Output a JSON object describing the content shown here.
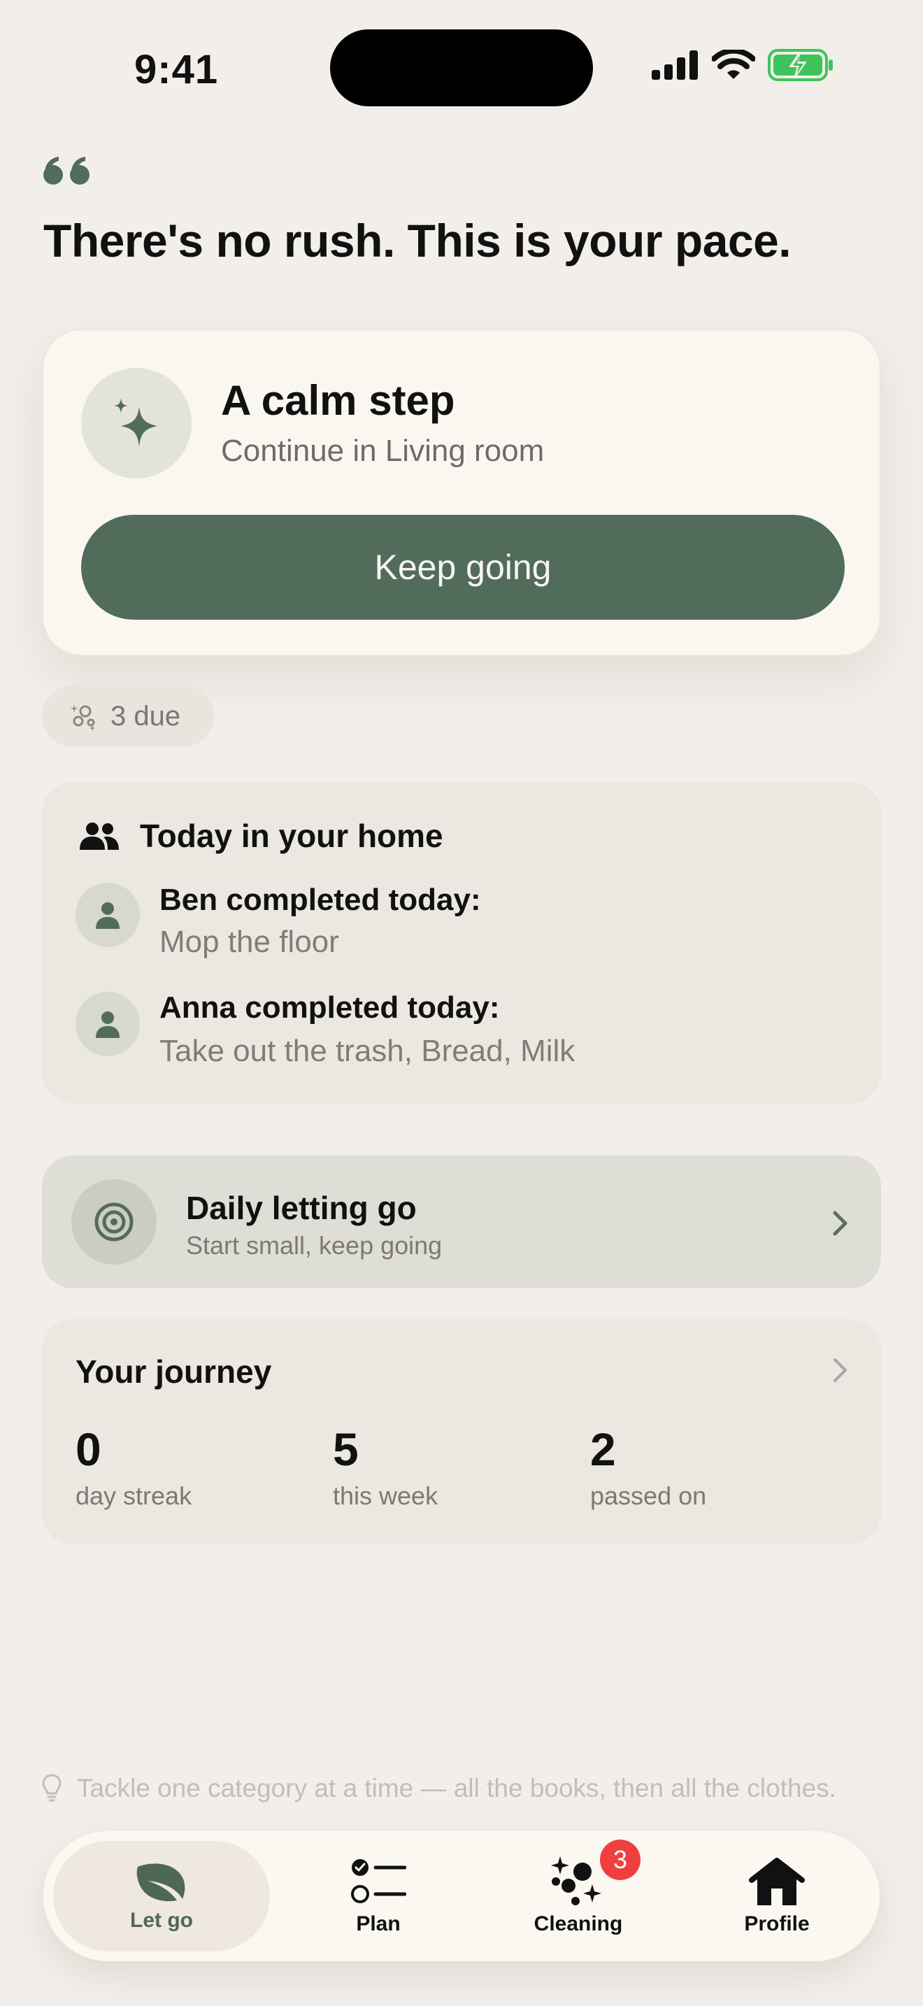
{
  "status_bar": {
    "time": "9:41"
  },
  "headline": "There's no rush. This is your pace.",
  "hero": {
    "title": "A calm step",
    "subtitle": "Continue in Living room",
    "button_label": "Keep going"
  },
  "due_chip": {
    "label": "3 due"
  },
  "today": {
    "title": "Today in your home",
    "activities": [
      {
        "name": "Ben completed today:",
        "detail": "Mop the floor"
      },
      {
        "name": "Anna completed today:",
        "detail": "Take out the trash, Bread, Milk"
      }
    ]
  },
  "letting_go": {
    "title": "Daily letting go",
    "subtitle": "Start small, keep going"
  },
  "journey": {
    "title": "Your journey",
    "stats": [
      {
        "value": "0",
        "label": "day streak"
      },
      {
        "value": "5",
        "label": "this week"
      },
      {
        "value": "2",
        "label": "passed on"
      }
    ]
  },
  "tip": "Tackle one category at a time — all the books, then all the clothes.",
  "tabs": [
    {
      "label": "Let go",
      "icon": "leaf-icon",
      "active": true
    },
    {
      "label": "Plan",
      "icon": "checklist-icon",
      "active": false
    },
    {
      "label": "Cleaning",
      "icon": "sparkle-bubbles-icon",
      "active": false,
      "badge": "3"
    },
    {
      "label": "Profile",
      "icon": "house-icon",
      "active": false
    }
  ],
  "colors": {
    "background": "#F2EFEA",
    "accent": "#526C5C",
    "card": "#FAF7F1",
    "badge": "#EF3F3F",
    "battery": "#3DC45A"
  }
}
